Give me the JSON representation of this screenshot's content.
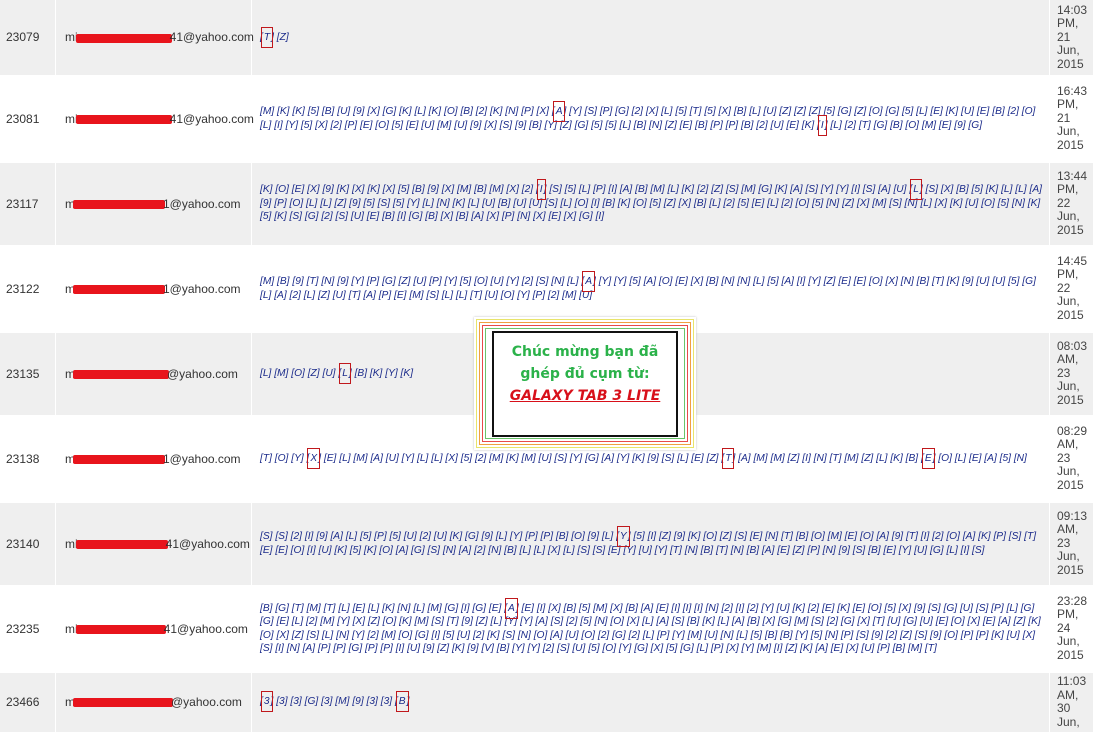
{
  "rows": [
    {
      "id": "23079",
      "email_prefix": "mi",
      "email_suffix": "41@yahoo.com",
      "redact_w": 96,
      "codes": [
        "T",
        "Z"
      ],
      "hl": [
        0
      ],
      "time": [
        "14:03",
        "PM,",
        "21",
        "Jun,",
        "2015"
      ],
      "h": 76
    },
    {
      "id": "23081",
      "email_prefix": "mi",
      "email_suffix": "41@yahoo.com",
      "redact_w": 96,
      "codes": [
        "M",
        "K",
        "K",
        "5",
        "B",
        "U",
        "9",
        "X",
        "G",
        "K",
        "L",
        "K",
        "O",
        "B",
        "2",
        "K",
        "N",
        "P",
        "X",
        "A",
        "Y",
        "S",
        "P",
        "G",
        "2",
        "X",
        "L",
        "5",
        "T",
        "5",
        "X",
        "B",
        "L",
        "U",
        "Z",
        "Z",
        "Z",
        "5",
        "G",
        "Z",
        "O",
        "G",
        "5",
        "L",
        "E",
        "K",
        "U",
        "E",
        "B",
        "2",
        "O",
        "L",
        "I",
        "Y",
        "5",
        "X",
        "2",
        "P",
        "E",
        "O",
        "5",
        "E",
        "U",
        "M",
        "U",
        "9",
        "X",
        "S",
        "9",
        "B",
        "Y",
        "Z",
        "G",
        "5",
        "5",
        "L",
        "B",
        "N",
        "Z",
        "E",
        "B",
        "P",
        "P",
        "B",
        "2",
        "U",
        "E",
        "K",
        "I",
        "L",
        "2",
        "T",
        "G",
        "B",
        "O",
        "M",
        "E",
        "9",
        "G"
      ],
      "hl": [
        19,
        88
      ],
      "time": [
        "16:43",
        "PM,",
        "21",
        "Jun,",
        "2015"
      ],
      "h": 85
    },
    {
      "id": "23117",
      "email_prefix": "m",
      "email_suffix": "1@yahoo.com",
      "redact_w": 92,
      "codes": [
        "K",
        "O",
        "E",
        "X",
        "9",
        "K",
        "X",
        "K",
        "X",
        "5",
        "B",
        "9",
        "X",
        "M",
        "B",
        "M",
        "X",
        "2",
        "I",
        "S",
        "5",
        "L",
        "P",
        "I",
        "A",
        "B",
        "M",
        "L",
        "K",
        "2",
        "Z",
        "S",
        "M",
        "G",
        "K",
        "A",
        "S",
        "Y",
        "Y",
        "I",
        "S",
        "A",
        "U",
        "L",
        "S",
        "X",
        "B",
        "5",
        "K",
        "L",
        "L",
        "A",
        "9",
        "P",
        "O",
        "L",
        "L",
        "Z",
        "9",
        "5",
        "S",
        "5",
        "Y",
        "L",
        "N",
        "K",
        "L",
        "U",
        "B",
        "U",
        "U",
        "S",
        "L",
        "O",
        "I",
        "B",
        "K",
        "O",
        "5",
        "Z",
        "X",
        "B",
        "L",
        "2",
        "5",
        "E",
        "L",
        "2",
        "O",
        "5",
        "N",
        "Z",
        "X",
        "M",
        "S",
        "N",
        "L",
        "X",
        "K",
        "U",
        "O",
        "5",
        "N",
        "K",
        "5",
        "K",
        "S",
        "G",
        "2",
        "S",
        "U",
        "E",
        "B",
        "I",
        "G",
        "B",
        "X",
        "B",
        "A",
        "X",
        "P",
        "N",
        "X",
        "E",
        "X",
        "G",
        "I"
      ],
      "hl": [
        18,
        43
      ],
      "time": [
        "13:44",
        "PM,",
        "22",
        "Jun,",
        "2015"
      ],
      "h": 85
    },
    {
      "id": "23122",
      "email_prefix": "m",
      "email_suffix": "1@yahoo.com",
      "redact_w": 92,
      "codes": [
        "M",
        "B",
        "9",
        "T",
        "N",
        "9",
        "Y",
        "P",
        "G",
        "Z",
        "U",
        "P",
        "Y",
        "5",
        "O",
        "U",
        "Y",
        "2",
        "S",
        "N",
        "L",
        "A",
        "Y",
        "Y",
        "5",
        "A",
        "O",
        "E",
        "X",
        "B",
        "N",
        "N",
        "L",
        "5",
        "A",
        "I",
        "Y",
        "Z",
        "E",
        "E",
        "O",
        "X",
        "N",
        "B",
        "T",
        "K",
        "9",
        "U",
        "U",
        "5",
        "G",
        "L",
        "A",
        "2",
        "L",
        "Z",
        "U",
        "T",
        "A",
        "P",
        "E",
        "M",
        "S",
        "L",
        "L",
        "T",
        "U",
        "O",
        "Y",
        "P",
        "2",
        "M",
        "U"
      ],
      "hl": [
        21
      ],
      "time": [
        "14:45",
        "PM,",
        "22",
        "Jun,",
        "2015"
      ],
      "h": 85
    },
    {
      "id": "23135",
      "email_prefix": "m",
      "email_suffix": "@yahoo.com",
      "redact_w": 96,
      "codes": [
        "L",
        "M",
        "O",
        "Z",
        "U",
        "L",
        "B",
        "K",
        "Y",
        "K"
      ],
      "hl": [
        5
      ],
      "time": [
        "08:03",
        "AM,",
        "23",
        "Jun,",
        "2015"
      ],
      "h": 85
    },
    {
      "id": "23138",
      "email_prefix": "m",
      "email_suffix": "1@yahoo.com",
      "redact_w": 92,
      "codes": [
        "T",
        "O",
        "Y",
        "X",
        "E",
        "L",
        "M",
        "A",
        "U",
        "Y",
        "L",
        "L",
        "X",
        "5",
        "2",
        "M",
        "K",
        "M",
        "U",
        "S",
        "Y",
        "G",
        "A",
        "Y",
        "K",
        "9",
        "S",
        "L",
        "E",
        "Z",
        "T",
        "A",
        "M",
        "M",
        "Z",
        "I",
        "N",
        "T",
        "M",
        "Z",
        "L",
        "K",
        "B",
        "E",
        "O",
        "L",
        "E",
        "A",
        "5",
        "N"
      ],
      "hl": [
        3,
        30,
        43
      ],
      "time": [
        "08:29",
        "AM,",
        "23",
        "Jun,",
        "2015"
      ],
      "h": 85
    },
    {
      "id": "23140",
      "email_prefix": "mi",
      "email_suffix": "41@yahoo.com",
      "redact_w": 92,
      "codes": [
        "S",
        "S",
        "2",
        "I",
        "9",
        "A",
        "L",
        "5",
        "P",
        "5",
        "U",
        "2",
        "U",
        "K",
        "G",
        "9",
        "L",
        "Y",
        "P",
        "P",
        "B",
        "O",
        "9",
        "L",
        "Y",
        "5",
        "I",
        "Z",
        "9",
        "K",
        "O",
        "Z",
        "S",
        "E",
        "N",
        "T",
        "B",
        "O",
        "M",
        "E",
        "O",
        "A",
        "9",
        "T",
        "I",
        "2",
        "O",
        "A",
        "K",
        "P",
        "S",
        "T",
        "E",
        "E",
        "O",
        "I",
        "U",
        "K",
        "5",
        "K",
        "O",
        "A",
        "G",
        "S",
        "N",
        "A",
        "2",
        "N",
        "B",
        "L",
        "L",
        "X",
        "L",
        "S",
        "S",
        "E",
        "Y",
        "U",
        "Y",
        "T",
        "N",
        "B",
        "T",
        "N",
        "B",
        "A",
        "E",
        "Z",
        "P",
        "N",
        "9",
        "S",
        "B",
        "E",
        "Y",
        "U",
        "G",
        "L",
        "I",
        "S"
      ],
      "hl": [
        24
      ],
      "time": [
        "09:13",
        "AM,",
        "23",
        "Jun,",
        "2015"
      ],
      "h": 85
    },
    {
      "id": "23235",
      "email_prefix": "mi",
      "email_suffix": "41@yahoo.com",
      "redact_w": 90,
      "codes": [
        "B",
        "G",
        "T",
        "M",
        "T",
        "L",
        "E",
        "L",
        "K",
        "N",
        "L",
        "M",
        "G",
        "I",
        "G",
        "E",
        "A",
        "E",
        "I",
        "X",
        "B",
        "5",
        "M",
        "X",
        "B",
        "A",
        "E",
        "I",
        "I",
        "I",
        "N",
        "2",
        "I",
        "2",
        "Y",
        "U",
        "K",
        "2",
        "E",
        "K",
        "E",
        "O",
        "5",
        "X",
        "9",
        "S",
        "G",
        "U",
        "S",
        "P",
        "L",
        "G",
        "G",
        "E",
        "L",
        "2",
        "M",
        "Y",
        "X",
        "Z",
        "O",
        "K",
        "M",
        "S",
        "T",
        "9",
        "Z",
        "L",
        "Y",
        "Y",
        "A",
        "S",
        "2",
        "5",
        "N",
        "O",
        "X",
        "L",
        "A",
        "S",
        "B",
        "K",
        "L",
        "A",
        "B",
        "X",
        "G",
        "M",
        "S",
        "2",
        "G",
        "X",
        "T",
        "U",
        "G",
        "U",
        "E",
        "O",
        "X",
        "E",
        "A",
        "Z",
        "K",
        "O",
        "X",
        "Z",
        "S",
        "L",
        "N",
        "Y",
        "2",
        "M",
        "O",
        "G",
        "I",
        "5",
        "U",
        "2",
        "K",
        "S",
        "N",
        "O",
        "A",
        "U",
        "O",
        "2",
        "G",
        "2",
        "L",
        "P",
        "Y",
        "M",
        "U",
        "N",
        "L",
        "5",
        "B",
        "B",
        "Y",
        "5",
        "N",
        "P",
        "S",
        "9",
        "2",
        "Z",
        "S",
        "9",
        "O",
        "P",
        "P",
        "K",
        "U",
        "X",
        "S",
        "I",
        "N",
        "A",
        "P",
        "P",
        "G",
        "P",
        "P",
        "I",
        "U",
        "9",
        "Z",
        "K",
        "9",
        "V",
        "B",
        "Y",
        "Y",
        "2",
        "S",
        "U",
        "5",
        "O",
        "Y",
        "G",
        "X",
        "5",
        "G",
        "L",
        "P",
        "X",
        "Y",
        "M",
        "I",
        "Z",
        "K",
        "A",
        "E",
        "X",
        "U",
        "P",
        "B",
        "M",
        "T"
      ],
      "hl": [
        16
      ],
      "time": [
        "23:28",
        "PM,",
        "24",
        "Jun,",
        "2015"
      ],
      "h": 85
    },
    {
      "id": "23466",
      "email_prefix": "m",
      "email_suffix": "@yahoo.com",
      "redact_w": 100,
      "codes": [
        "3",
        "3",
        "3",
        "G",
        "3",
        "M",
        "9",
        "3",
        "3",
        "B"
      ],
      "hl": [
        0,
        9
      ],
      "time": [
        "11:03",
        "AM,",
        "30",
        "Jun,",
        ""
      ],
      "h": 62
    }
  ],
  "popup": {
    "line1": "Chúc mừng bạn đã",
    "line2": "ghép đủ cụm từ:",
    "prize": "GALAXY TAB 3 LITE"
  }
}
